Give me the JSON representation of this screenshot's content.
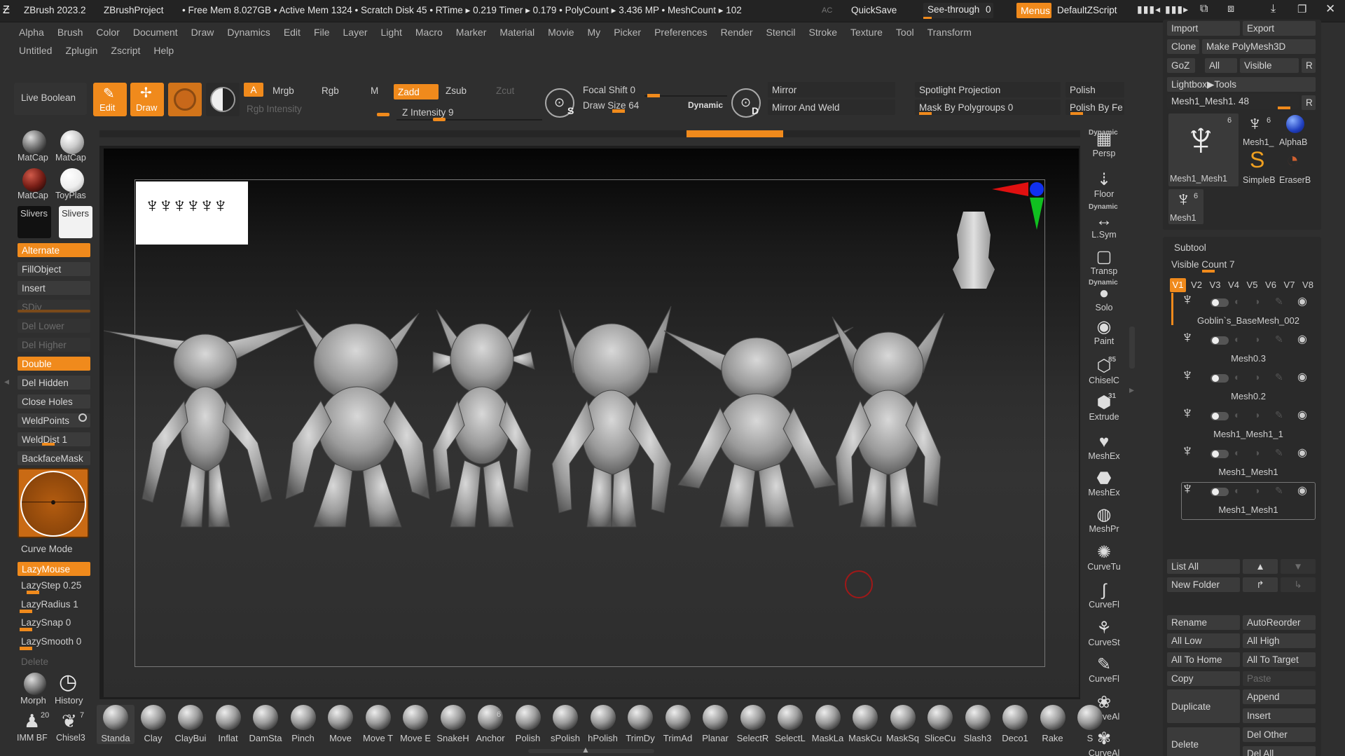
{
  "titlebar": {
    "app": "ZBrush 2023.2",
    "project": "ZBrushProject",
    "stats": "• Free Mem 8.027GB • Active Mem 1324 • Scratch Disk 45 • RTime ▸ 0.219 Timer ▸ 0.179 • PolyCount ▸ 3.436 MP • MeshCount ▸ 102",
    "ac": "AC",
    "quicksave": "QuickSave",
    "see_through_label": "See-through",
    "see_through_value": "0",
    "menus": "Menus",
    "script": "DefaultZScript"
  },
  "menubar": {
    "row1": [
      "Alpha",
      "Brush",
      "Color",
      "Document",
      "Draw",
      "Dynamics",
      "Edit",
      "File",
      "Layer",
      "Light",
      "Macro",
      "Marker",
      "Material",
      "Movie",
      "My",
      "Picker",
      "Preferences",
      "Render",
      "Stencil",
      "Stroke",
      "Texture",
      "Tool",
      "Transform"
    ],
    "row2": [
      "Untitled",
      "Zplugin",
      "Zscript",
      "Help"
    ]
  },
  "toolbar": {
    "live_boolean": "Live Boolean",
    "edit": "Edit",
    "draw": "Draw",
    "a": "A",
    "mrgb": "Mrgb",
    "rgb": "Rgb",
    "m": "M",
    "zadd": "Zadd",
    "zsub": "Zsub",
    "zcut": "Zcut",
    "rgb_intensity": "Rgb Intensity",
    "z_intensity": "Z Intensity 9",
    "focal_shift": "Focal Shift 0",
    "draw_size": "Draw Size 64",
    "dynamic": "Dynamic",
    "s": "S",
    "d": "D",
    "mirror": "Mirror",
    "mirror_weld": "Mirror And Weld",
    "spotlight": "Spotlight Projection",
    "mask_polygroups": "Mask By Polygroups 0",
    "polish": "Polish",
    "polish_by": "Polish By Fe"
  },
  "left_shelf": {
    "materials": [
      "MatCap",
      "MatCap",
      "MatCap",
      "ToyPlas"
    ],
    "slivers": [
      "Slivers",
      "Slivers"
    ],
    "buttons": [
      {
        "label": "Alternate",
        "state": "on"
      },
      {
        "label": "FillObject",
        "state": "normal"
      },
      {
        "label": "Insert",
        "state": "normal"
      },
      {
        "label": "SDiv",
        "state": "disabled"
      },
      {
        "label": "Del Lower",
        "state": "disabled"
      },
      {
        "label": "Del Higher",
        "state": "disabled"
      },
      {
        "label": "Double",
        "state": "on"
      },
      {
        "label": "Del Hidden",
        "state": "normal"
      },
      {
        "label": "Close Holes",
        "state": "normal"
      },
      {
        "label": "WeldPoints",
        "state": "normal"
      },
      {
        "label": "WeldDist 1",
        "state": "normal"
      },
      {
        "label": "BackfaceMask",
        "state": "normal"
      }
    ],
    "curve_mode": "Curve Mode",
    "lazymouse": "LazyMouse",
    "lazystep": "LazyStep 0.25",
    "lazyradius": "LazyRadius 1",
    "lazysnap": "LazySnap 0",
    "lazysmooth": "LazySmooth 0",
    "delete": "Delete",
    "morph": "Morph",
    "history": "History",
    "imm": "IMM BF",
    "imm_count": "20",
    "chisel": "Chisel3",
    "chisel_count": "7"
  },
  "right_shelf": [
    "Persp",
    "Floor",
    "L.Sym",
    "Transp",
    "Solo",
    "Paint",
    "ChiselC",
    "Extrude",
    "MeshEx",
    "MeshEx",
    "MeshPr",
    "CurveTu",
    "CurveFl",
    "CurveSt",
    "CurveFl",
    "CurveAl",
    "CurveAl"
  ],
  "right_shelf_badges": {
    "dynamic": "Dynamic",
    "chisel": "85",
    "extrude": "31"
  },
  "tool_panel": {
    "import": "Import",
    "export": "Export",
    "clone": "Clone",
    "make_polymesh": "Make PolyMesh3D",
    "goz": "GoZ",
    "all": "All",
    "visible": "Visible",
    "r": "R",
    "lightbox": "Lightbox▶Tools",
    "current_tool": "Mesh1_Mesh1. 48",
    "thumbs": [
      "Mesh1_Mesh1",
      "Mesh1_",
      "AlphaB",
      "SimpleB",
      "EraserB",
      "Mesh1"
    ],
    "thumb_count": "6",
    "subtool_title": "Subtool",
    "visible_count": "Visible Count 7",
    "versions": [
      "V1",
      "V2",
      "V3",
      "V4",
      "V5",
      "V6",
      "V7",
      "V8"
    ],
    "subtools": [
      "Goblin`s_BaseMesh_002",
      "Mesh0.3",
      "Mesh0.2",
      "Mesh1_Mesh1_1",
      "Mesh1_Mesh1",
      "Mesh1_Mesh1"
    ],
    "list_all": "List All",
    "new_folder": "New Folder",
    "rename": "Rename",
    "autoreorder": "AutoReorder",
    "all_low": "All Low",
    "all_high": "All High",
    "all_to_home": "All To Home",
    "all_to_target": "All To Target",
    "copy": "Copy",
    "paste": "Paste",
    "append": "Append",
    "duplicate": "Duplicate",
    "insert": "Insert",
    "delete": "Delete",
    "del_other": "Del Other",
    "del_all": "Del All"
  },
  "brushes": [
    "Standa",
    "Clay",
    "ClayBui",
    "Inflat",
    "DamSta",
    "Pinch",
    "Move",
    "Move T",
    "Move E",
    "SnakeH",
    "Anchor",
    "Polish",
    "sPolish",
    "hPolish",
    "TrimDy",
    "TrimAd",
    "Planar",
    "SelectR",
    "SelectL",
    "MaskLa",
    "MaskCu",
    "MaskSq",
    "SliceCu",
    "Slash3",
    "Deco1",
    "Rake",
    "S"
  ],
  "anchor_count": "6",
  "colors": {
    "accent": "#f08a1c",
    "bg": "#2f2f2f",
    "canvas": "#2a2a2a"
  }
}
